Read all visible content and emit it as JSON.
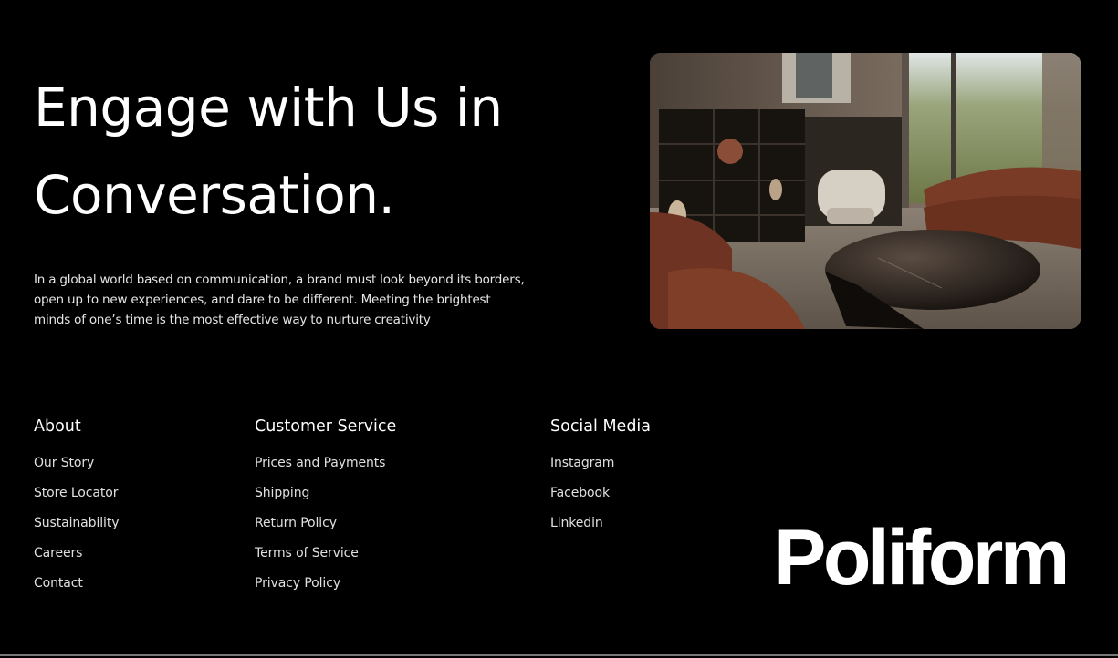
{
  "hero": {
    "headline_line1": "Engage with Us in",
    "headline_line2": "Conversation.",
    "description": "In a global world based on communication, a brand must look beyond its borders, open up to new experiences, and dare to be different. Meeting the brightest minds of one’s time is the most effective way to nurture creativity"
  },
  "footer": {
    "columns": [
      {
        "title": "About",
        "links": [
          "Our Story",
          "Store Locator",
          "Sustainability",
          "Careers",
          "Contact"
        ]
      },
      {
        "title": "Customer Service",
        "links": [
          "Prices and Payments",
          "Shipping",
          "Return Policy",
          "Terms of Service",
          "Privacy Policy"
        ]
      },
      {
        "title": "Social Media",
        "links": [
          "Instagram",
          "Facebook",
          "Linkedin"
        ]
      }
    ],
    "logo": "Poliform"
  },
  "colors": {
    "background": "#000000",
    "text": "#ffffff",
    "sofa": "#7a3b26",
    "table": "#1c1714"
  }
}
